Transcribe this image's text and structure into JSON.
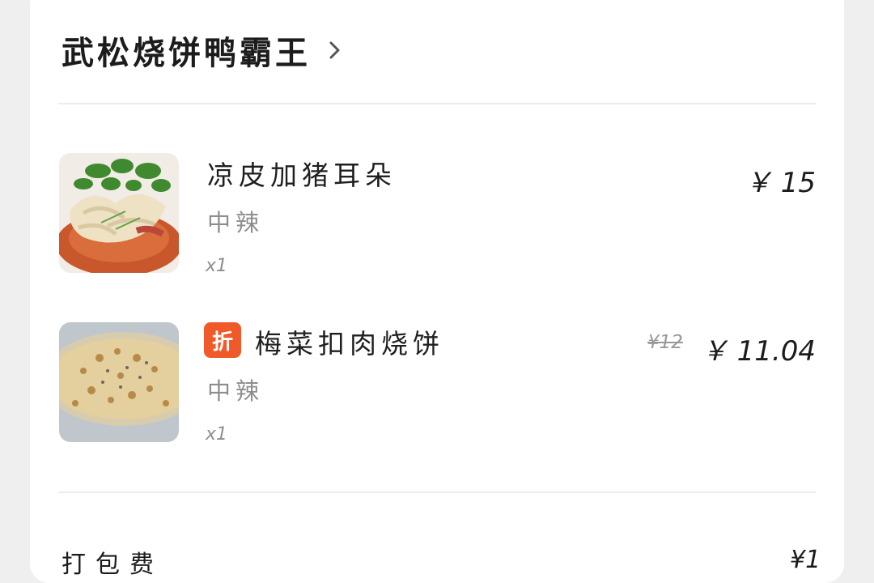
{
  "shop": {
    "name": "武松烧饼鸭霸王"
  },
  "items": [
    {
      "name": "凉皮加猪耳朵",
      "spec": "中辣",
      "qty": "x1",
      "price": "￥ 15"
    },
    {
      "badge": "折",
      "name": "梅菜扣肉烧饼",
      "spec": "中辣",
      "qty": "x1",
      "original_price": "¥12",
      "price": "￥ 11.04"
    }
  ],
  "packaging": {
    "label": "打包费",
    "price": "¥1"
  },
  "colors": {
    "discount_badge": "#f05a2a",
    "card": "#ffffff",
    "background": "#efefef"
  }
}
